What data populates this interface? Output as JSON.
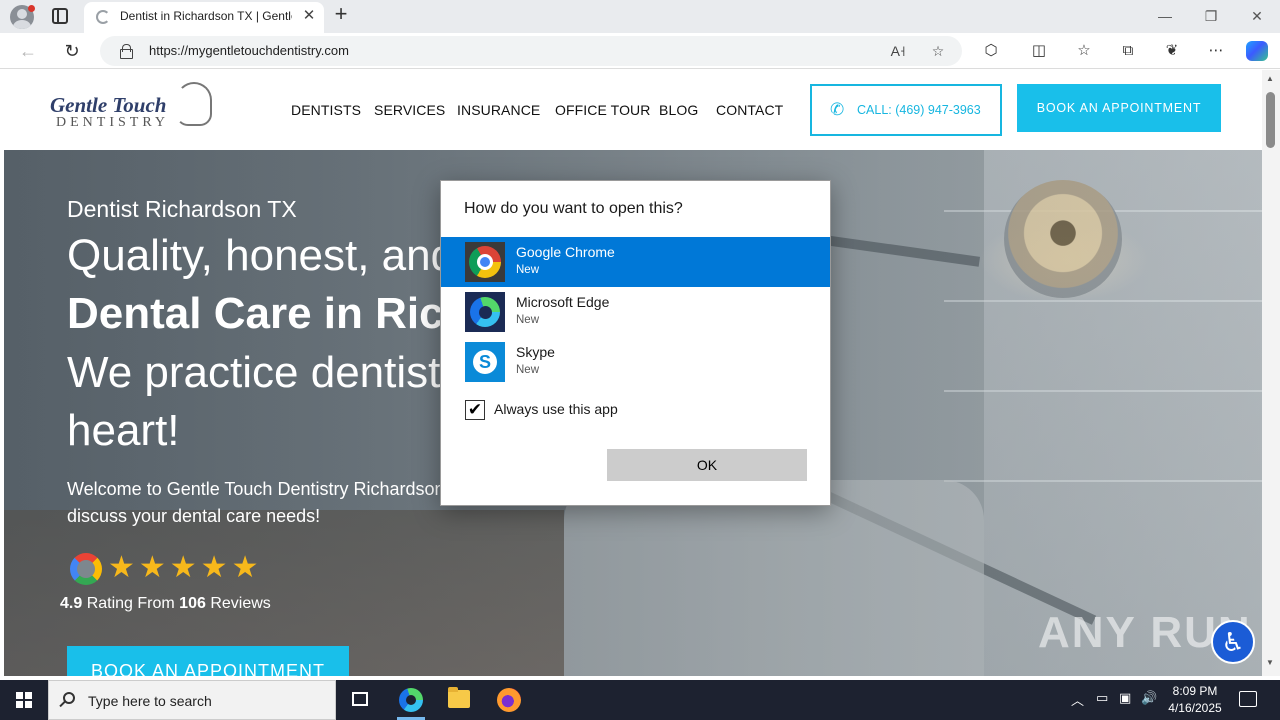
{
  "browser": {
    "tab_title": "Dentist in Richardson TX | Gentle Touch Dentistry",
    "tab_close": "✕",
    "new_tab": "+",
    "url": "https://mygentletouchdentistry.com",
    "window_controls": {
      "minimize": "—",
      "restore": "❐",
      "close": "✕"
    },
    "nav": {
      "back": "←",
      "refresh": "↻"
    },
    "toolbar_icons": [
      "read-aloud-icon",
      "favorite-star-icon",
      "extensions-icon",
      "split-screen-icon",
      "favorites-icon",
      "collections-icon",
      "performance-icon",
      "more-icon",
      "copilot-icon"
    ]
  },
  "site": {
    "logo": {
      "line1": "Gentle Touch",
      "line2": "DENTISTRY"
    },
    "nav": [
      "DENTISTS",
      "SERVICES",
      "INSURANCE",
      "OFFICE TOUR",
      "BLOG",
      "CONTACT"
    ],
    "call": "CALL: (469) 947-3963",
    "book_top": "BOOK AN APPOINTMENT",
    "hero": {
      "subtitle": "Dentist Richardson TX",
      "line1": "Quality, honest, and",
      "line2": "Dental Care in Richardson",
      "line3": "We practice dentistry with",
      "line4": "heart!",
      "welcome": "Welcome to Gentle Touch Dentistry Richardson, or give us a call to discuss your dental care needs!",
      "stars": "★★★★★",
      "rating_value": "4.9",
      "rating_mid": " Rating From ",
      "rating_count": "106",
      "rating_end": " Reviews",
      "book": "BOOK AN APPOINTMENT"
    },
    "watermark": "ANY RUN"
  },
  "dialog": {
    "title": "How do you want to open this?",
    "apps": [
      {
        "name": "Google Chrome",
        "tag": "New",
        "selected": true
      },
      {
        "name": "Microsoft Edge",
        "tag": "New",
        "selected": false
      },
      {
        "name": "Skype",
        "tag": "New",
        "selected": false
      }
    ],
    "always_label": "Always use this app",
    "always_checked": true,
    "checkmark": "✔",
    "ok": "OK"
  },
  "taskbar": {
    "search_placeholder": "Type here to search",
    "time": "8:09 PM",
    "date": "4/16/2025",
    "tray": {
      "chevron": "︿",
      "volume": "🔊"
    }
  },
  "colors": {
    "accent": "#19bfea",
    "selection": "#0078d7",
    "taskbar": "#1d2230"
  }
}
